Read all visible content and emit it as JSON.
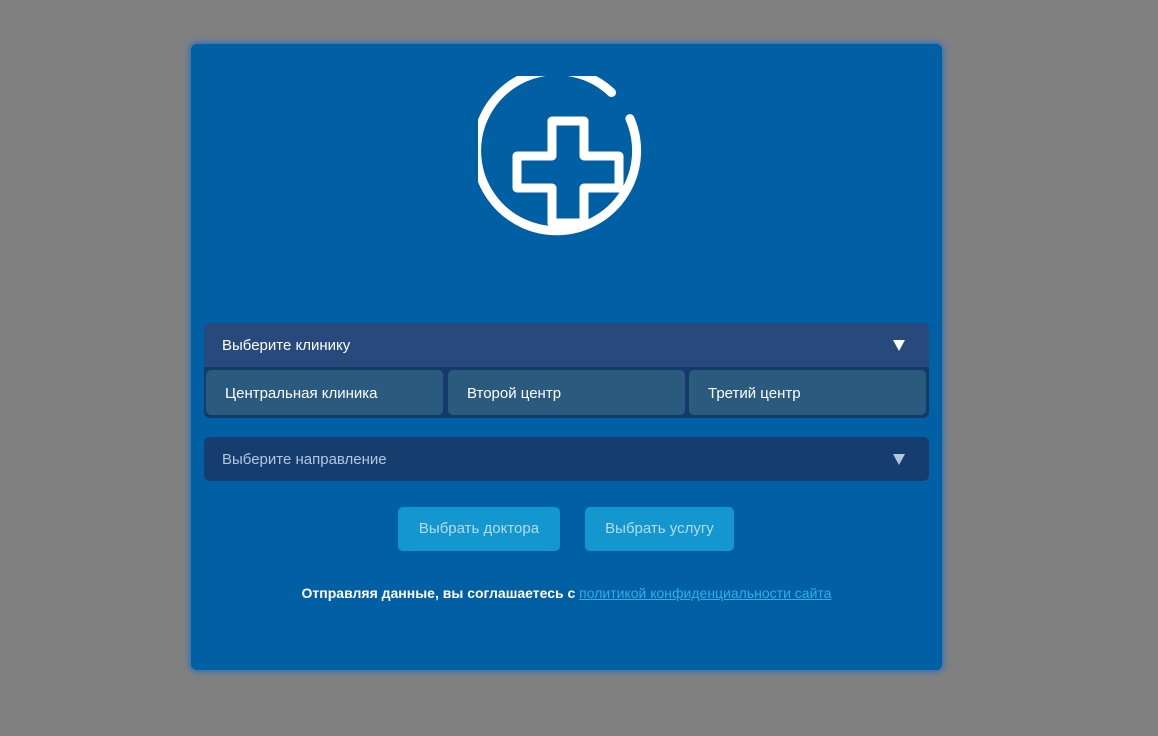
{
  "clinic_select": {
    "placeholder": "Выберите клинику",
    "options": [
      {
        "label": "Центральная клиника"
      },
      {
        "label": "Второй центр"
      },
      {
        "label": "Третий центр"
      }
    ]
  },
  "direction_select": {
    "placeholder": "Выберите направление"
  },
  "buttons": {
    "choose_doctor": "Выбрать доктора",
    "choose_service": "Выбрать услугу"
  },
  "consent": {
    "text": "Отправляя данные, вы соглашаетесь с ",
    "link": "политикой конфиденциальности сайта"
  },
  "colors": {
    "modal_bg": "#015fa3",
    "button_bg": "#1496ce",
    "link": "#2fb0e8"
  },
  "icons": {
    "logo": "medical-cross-icon",
    "dropdown": "chevron-down-icon"
  }
}
